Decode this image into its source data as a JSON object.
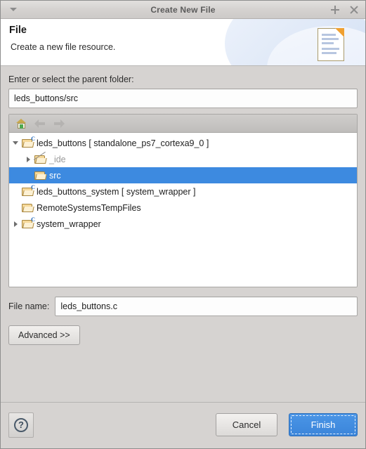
{
  "window": {
    "title": "Create New File",
    "menu_icon": "chevron-down-icon",
    "maximize_icon": "plus-icon",
    "close_icon": "close-icon"
  },
  "header": {
    "title": "File",
    "subtitle": "Create a new file resource.",
    "icon": "new-file-document-icon"
  },
  "parent_folder": {
    "label": "Enter or select the parent folder:",
    "value": "leds_buttons/src",
    "placeholder": ""
  },
  "tree_toolbar": {
    "home_label": "home-icon",
    "back_label": "back-arrow-icon",
    "forward_label": "forward-arrow-icon"
  },
  "tree": {
    "items": [
      {
        "label": "leds_buttons [ standalone_ps7_cortexa9_0 ]",
        "depth": 0,
        "twisty": "open",
        "icon": "c-project-folder-icon",
        "selected": false,
        "dim": false
      },
      {
        "label": "_ide",
        "depth": 1,
        "twisty": "closed",
        "icon": "linked-folder-icon",
        "selected": false,
        "dim": true
      },
      {
        "label": "src",
        "depth": 1,
        "twisty": "none",
        "icon": "folder-icon",
        "selected": true,
        "dim": false
      },
      {
        "label": "leds_buttons_system [ system_wrapper ]",
        "depth": 0,
        "twisty": "none",
        "icon": "c-project-folder-icon",
        "selected": false,
        "dim": false
      },
      {
        "label": "RemoteSystemsTempFiles",
        "depth": 0,
        "twisty": "none",
        "icon": "folder-icon",
        "selected": false,
        "dim": false
      },
      {
        "label": "system_wrapper",
        "depth": 0,
        "twisty": "closed",
        "icon": "c-project-folder-icon",
        "selected": false,
        "dim": false
      }
    ]
  },
  "file_name": {
    "label": "File name:",
    "value": "leds_buttons.c",
    "placeholder": ""
  },
  "advanced": {
    "label": "Advanced >>"
  },
  "footer": {
    "help_label": "?",
    "cancel_label": "Cancel",
    "finish_label": "Finish"
  },
  "colors": {
    "selection_blue": "#3d8ae0",
    "primary_button": "#3b85da",
    "window_bg": "#d6d3d1"
  }
}
